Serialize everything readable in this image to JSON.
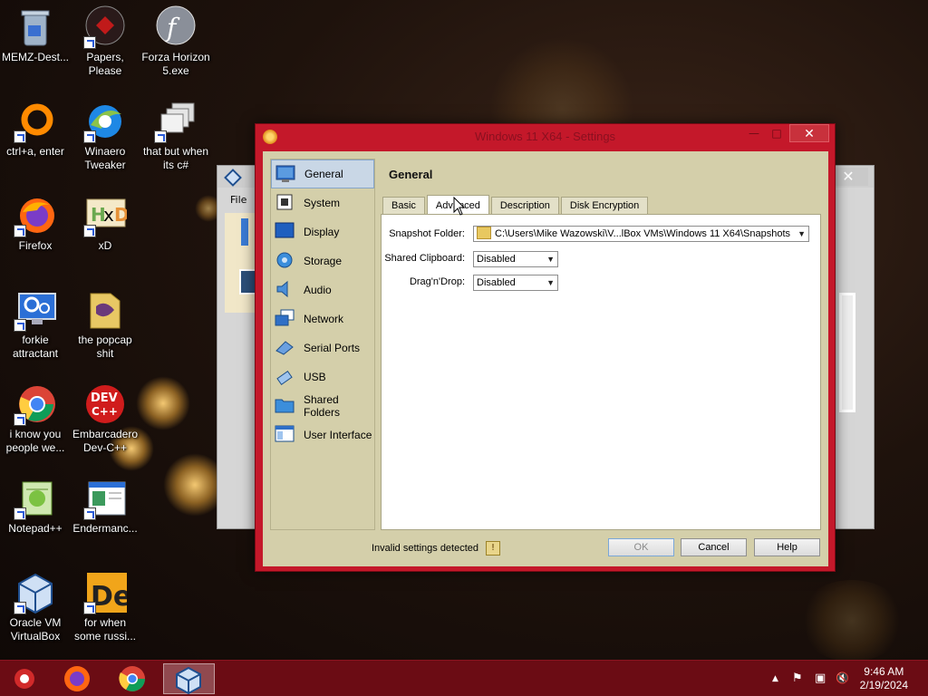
{
  "desktop": {
    "icons": [
      {
        "label": "MEMZ-Dest...",
        "icon": "recycle-bin-icon"
      },
      {
        "label": "Papers, Please",
        "icon": "papers-please-icon"
      },
      {
        "label": "Forza Horizon 5.exe",
        "icon": "flash-icon"
      },
      {
        "label": "ctrl+a, enter",
        "icon": "orange-ring-icon"
      },
      {
        "label": "Winaero Tweaker",
        "icon": "winaero-icon"
      },
      {
        "label": "that but when its c#",
        "icon": "stacked-windows-icon"
      },
      {
        "label": "Firefox",
        "icon": "firefox-icon"
      },
      {
        "label": "xD",
        "icon": "hxd-icon"
      },
      {
        "label": "forkie attractant",
        "icon": "monitor-gear-icon"
      },
      {
        "label": "the popcap shit",
        "icon": "folder-icon"
      },
      {
        "label": "i know you people we...",
        "icon": "chrome-icon"
      },
      {
        "label": "Embarcadero Dev-C++",
        "icon": "devcpp-icon"
      },
      {
        "label": "Notepad++",
        "icon": "notepadpp-icon"
      },
      {
        "label": "Endermanc...",
        "icon": "window-doc-icon"
      },
      {
        "label": "Oracle VM VirtualBox",
        "icon": "virtualbox-icon"
      },
      {
        "label": "for when some russi...",
        "icon": "de-icon"
      }
    ]
  },
  "bg_window": {
    "menu_file": "File",
    "close_glyph": "✕"
  },
  "dialog": {
    "title": "Windows 11 X64 - Settings",
    "close_glyph": "✕",
    "min_glyph": "—",
    "max_glyph": "□",
    "categories": [
      {
        "label": "General",
        "icon": "general-icon",
        "selected": true
      },
      {
        "label": "System",
        "icon": "system-chip-icon"
      },
      {
        "label": "Display",
        "icon": "display-icon"
      },
      {
        "label": "Storage",
        "icon": "storage-icon"
      },
      {
        "label": "Audio",
        "icon": "audio-icon"
      },
      {
        "label": "Network",
        "icon": "network-icon"
      },
      {
        "label": "Serial Ports",
        "icon": "serial-port-icon"
      },
      {
        "label": "USB",
        "icon": "usb-icon"
      },
      {
        "label": "Shared Folders",
        "icon": "shared-folder-icon"
      },
      {
        "label": "User Interface",
        "icon": "user-interface-icon"
      }
    ],
    "heading": "General",
    "tabs": [
      {
        "label": "Basic",
        "active": false
      },
      {
        "label": "Advanced",
        "active": true
      },
      {
        "label": "Description",
        "active": false
      },
      {
        "label": "Disk Encryption",
        "active": false
      }
    ],
    "fields": {
      "snapshot_label": "Snapshot Folder:",
      "snapshot_value": "C:\\Users\\Mike Wazowski\\V...lBox VMs\\Windows 11 X64\\Snapshots",
      "clipboard_label": "Shared Clipboard:",
      "clipboard_value": "Disabled",
      "dragdrop_label": "Drag'n'Drop:",
      "dragdrop_value": "Disabled"
    },
    "footer": {
      "warning_text": "Invalid settings detected",
      "ok": "OK",
      "cancel": "Cancel",
      "help": "Help"
    }
  },
  "taskbar": {
    "items": [
      "memz-icon",
      "firefox-icon",
      "chrome-icon",
      "virtualbox-icon"
    ],
    "tray": {
      "chevron": "▲",
      "flag": "⚑",
      "network": "▣",
      "volume": "🔇"
    },
    "time": "9:46 AM",
    "date": "2/19/2024"
  },
  "colors": {
    "dialog_frame": "#c4182a",
    "dialog_body": "#d4cfaa",
    "taskbar": "#6b0c14",
    "selected_category": "#c9d7e6"
  }
}
